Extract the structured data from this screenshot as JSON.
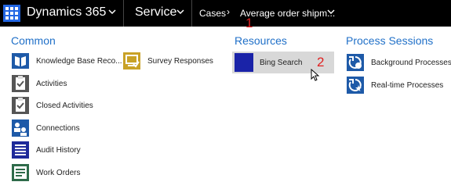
{
  "header": {
    "app_name": "Dynamics 365",
    "area": "Service",
    "breadcrumb": "Cases",
    "breadcrumb_separator": "›",
    "record_title": "Average order shipm..."
  },
  "annotations": {
    "marker_1": "1",
    "marker_2": "2"
  },
  "colors": {
    "accent": "#2070c8",
    "topbar": "#000000",
    "waffle": "#2266e3",
    "marker": "#e02020"
  },
  "sections": {
    "common": {
      "title": "Common",
      "items": [
        {
          "label": "Knowledge Base Reco...",
          "icon": "book-icon"
        },
        {
          "label": "Activities",
          "icon": "activities-icon"
        },
        {
          "label": "Closed Activities",
          "icon": "closed-activities-icon"
        },
        {
          "label": "Connections",
          "icon": "connections-icon"
        },
        {
          "label": "Audit History",
          "icon": "audit-history-icon"
        },
        {
          "label": "Work Orders",
          "icon": "work-orders-icon"
        },
        {
          "label": "Survey Responses",
          "icon": "survey-icon"
        }
      ]
    },
    "resources": {
      "title": "Resources",
      "items": [
        {
          "label": "Bing Search",
          "icon": "bing-icon"
        }
      ]
    },
    "process_sessions": {
      "title": "Process Sessions",
      "items": [
        {
          "label": "Background Processes",
          "icon": "background-process-icon"
        },
        {
          "label": "Real-time Processes",
          "icon": "realtime-process-icon"
        }
      ]
    }
  }
}
